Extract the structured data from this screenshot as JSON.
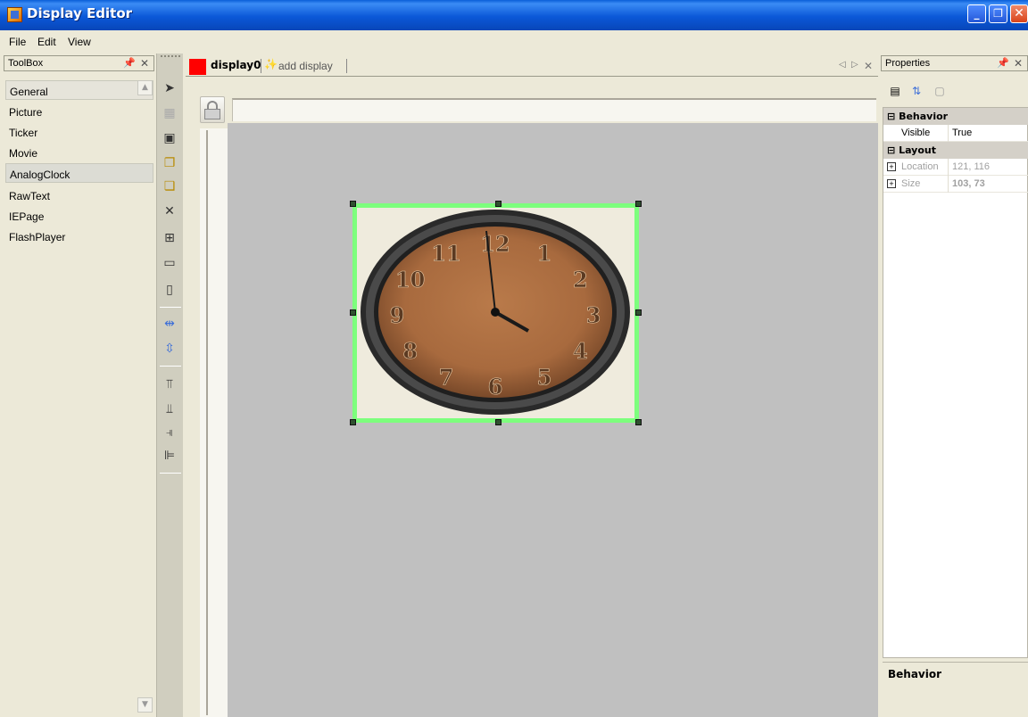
{
  "window": {
    "title": "Display Editor",
    "minimize": "_",
    "maximize": "❐",
    "close": "✕"
  },
  "menu": {
    "items": [
      "File",
      "Edit",
      "View"
    ]
  },
  "toolbox": {
    "title": "ToolBox",
    "items": [
      "General",
      "Picture",
      "Ticker",
      "Movie",
      "AnalogClock",
      "RawText",
      "IEPage",
      "FlashPlayer"
    ],
    "selected": "AnalogClock"
  },
  "tabs": {
    "active": "display0",
    "add": "add display"
  },
  "clock": {
    "numerals": [
      "12",
      "1",
      "2",
      "3",
      "4",
      "5",
      "6",
      "7",
      "8",
      "9",
      "10",
      "11"
    ]
  },
  "properties": {
    "title": "Properties",
    "categories": [
      {
        "name": "Behavior",
        "rows": [
          {
            "key": "Visible",
            "value": "True"
          }
        ]
      },
      {
        "name": "Layout",
        "rows": [
          {
            "key": "Location",
            "value": "121, 116"
          },
          {
            "key": "Size",
            "value": "103, 73"
          }
        ]
      }
    ],
    "description_title": "Behavior"
  },
  "colors": {
    "selection": "#7dff7d",
    "canvas": "#c0c0c0",
    "titlebar": "#0b58d8",
    "display_swatch": "#ff0000"
  }
}
